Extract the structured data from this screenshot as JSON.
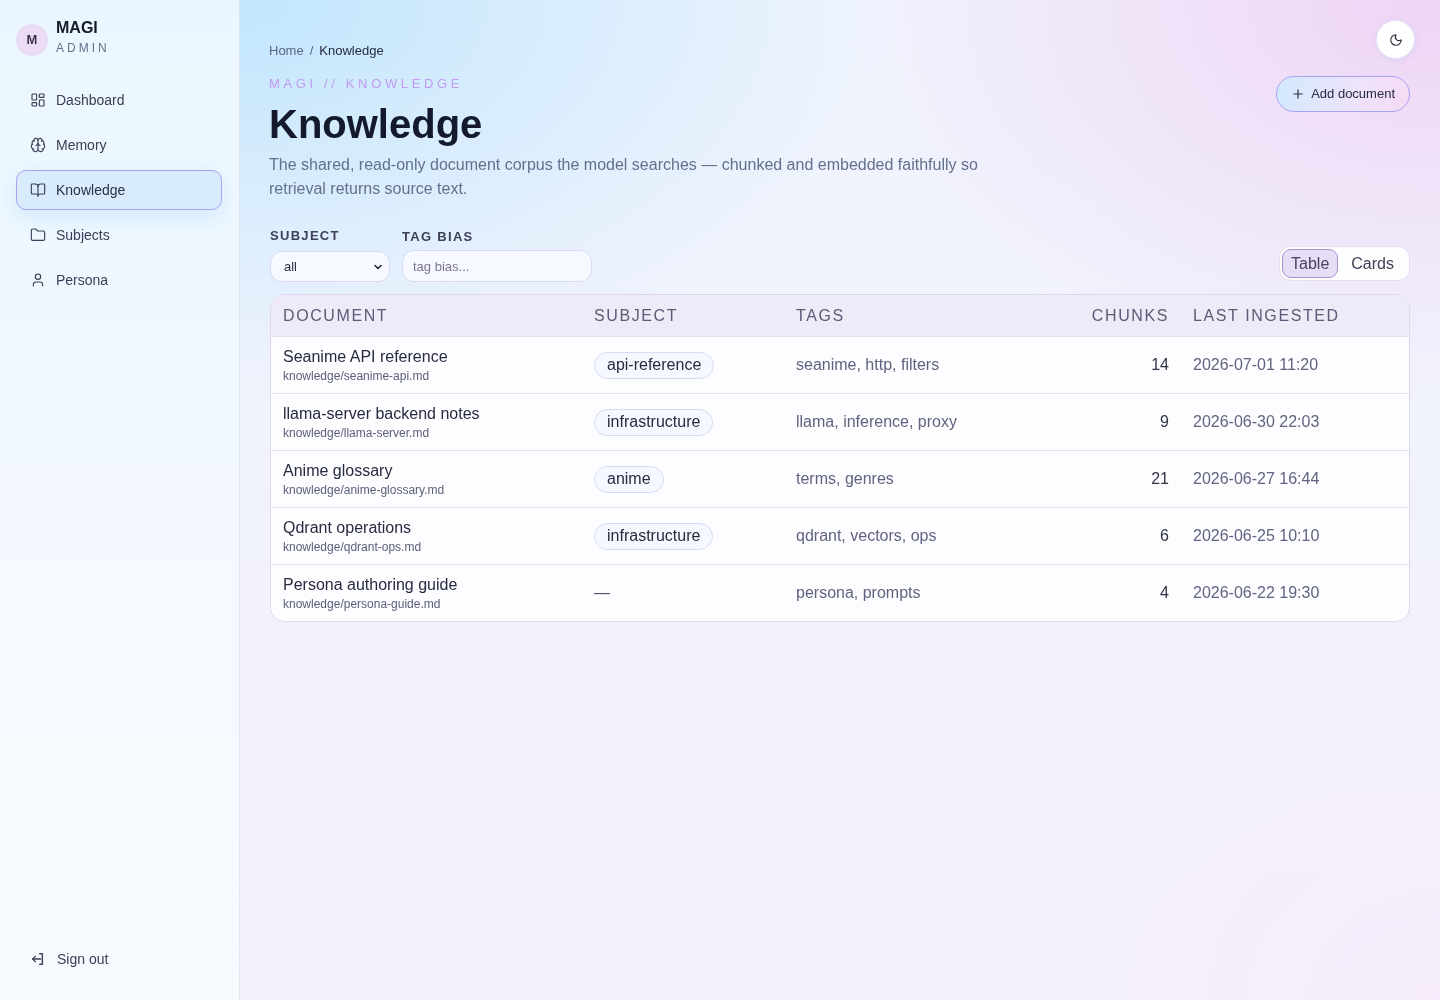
{
  "sidebar": {
    "brand": {
      "initial": "M",
      "name": "MAGI",
      "subtitle": "ADMIN"
    },
    "items": [
      {
        "label": "Dashboard",
        "selected": false
      },
      {
        "label": "Memory",
        "selected": false
      },
      {
        "label": "Knowledge",
        "selected": true
      },
      {
        "label": "Subjects",
        "selected": false
      },
      {
        "label": "Persona",
        "selected": false
      }
    ],
    "footer_item": {
      "label": "Sign out"
    }
  },
  "header": {
    "breadcrumb": [
      "Home",
      "Knowledge"
    ],
    "separator": "/",
    "eyebrow": "MAGI // KNOWLEDGE",
    "title": "Knowledge",
    "description": "The shared, read-only document corpus the model searches — chunked and embedded faithfully so retrieval returns source text."
  },
  "actions": {
    "add_button": "Add document"
  },
  "filters": [
    {
      "kind": "select",
      "label": "SUBJECT",
      "value": "all"
    },
    {
      "kind": "text",
      "label": "TAG BIAS",
      "placeholder": "tag bias..."
    }
  ],
  "view_toggle": [
    {
      "label": "Table",
      "selected": true
    },
    {
      "label": "Cards",
      "selected": false
    }
  ],
  "table": {
    "columns": [
      "DOCUMENT",
      "SUBJECT",
      "TAGS",
      "CHUNKS",
      "LAST INGESTED"
    ],
    "rows": [
      {
        "title": "Seanime API reference",
        "path": "knowledge/seanime-api.md",
        "subject": {
          "kind": "tag",
          "label": "api-reference"
        },
        "tags": "seanime, http, filters",
        "chunks": "14",
        "last_ingested": "2026-07-01 11:20"
      },
      {
        "title": "llama-server backend notes",
        "path": "knowledge/llama-server.md",
        "subject": {
          "kind": "tag",
          "label": "infrastructure"
        },
        "tags": "llama, inference, proxy",
        "chunks": "9",
        "last_ingested": "2026-06-30 22:03"
      },
      {
        "title": "Anime glossary",
        "path": "knowledge/anime-glossary.md",
        "subject": {
          "kind": "tag",
          "label": "anime"
        },
        "tags": "terms, genres",
        "chunks": "21",
        "last_ingested": "2026-06-27 16:44"
      },
      {
        "title": "Qdrant operations",
        "path": "knowledge/qdrant-ops.md",
        "subject": {
          "kind": "tag",
          "label": "infrastructure"
        },
        "tags": "qdrant, vectors, ops",
        "chunks": "6",
        "last_ingested": "2026-06-25 10:10"
      },
      {
        "title": "Persona authoring guide",
        "path": "knowledge/persona-guide.md",
        "subject": {
          "kind": "empty",
          "label": "—"
        },
        "tags": "persona, prompts",
        "chunks": "4",
        "last_ingested": "2026-06-22 19:30"
      }
    ]
  }
}
